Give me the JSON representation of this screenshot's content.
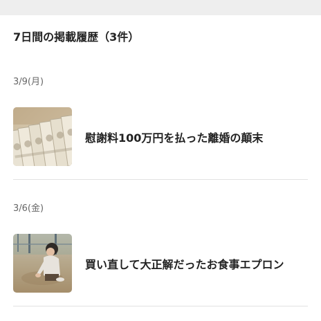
{
  "history": {
    "title": "7日間の掲載履歴（3件）",
    "groups": [
      {
        "date": "3/9(月)",
        "article": {
          "title": "慰謝料100万円を払った離婚の顛末",
          "thumbnail": "banknotes-photo"
        }
      },
      {
        "date": "3/6(金)",
        "article": {
          "title": "買い直して大正解だったお食事エプロン",
          "thumbnail": "child-playing-in-sand-photo"
        }
      }
    ]
  }
}
